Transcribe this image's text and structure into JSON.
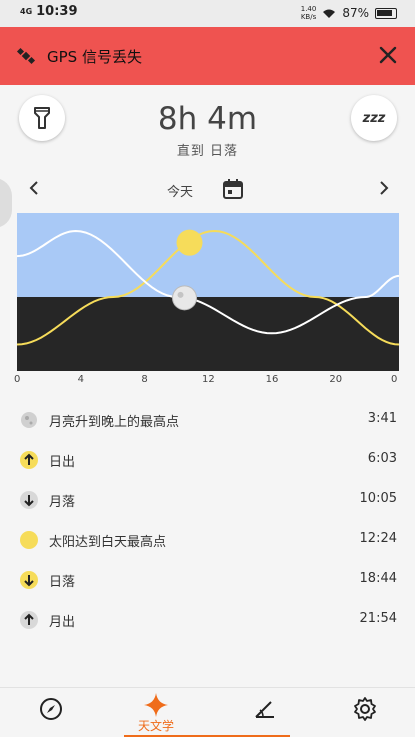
{
  "status_bar": {
    "network": "4G",
    "time": "10:39",
    "net_speed_top": "1.40",
    "net_speed_bottom": "KB/s",
    "battery": "87%"
  },
  "banner": {
    "text": "GPS 信号丢失",
    "icon": "satellite-icon",
    "color": "#ef5350"
  },
  "header": {
    "duration": "8h 4m",
    "subtitle": "直到 日落",
    "left_button_icon": "flashlight-icon",
    "right_button_text": "zzz"
  },
  "date_nav": {
    "label": "今天",
    "prev_icon": "chevron-left-icon",
    "next_icon": "chevron-right-icon",
    "calendar_icon": "calendar-icon"
  },
  "chart_data": {
    "type": "line",
    "x_ticks": [
      "0",
      "4",
      "8",
      "12",
      "16",
      "20",
      "0"
    ],
    "xlim": [
      0,
      24
    ],
    "colors": {
      "sky": "#a9c9f6",
      "night": "#262626",
      "sun": "#f6dc5a",
      "moon": "#ffffff"
    },
    "series": [
      {
        "key": "sun",
        "values": [
          [
            0,
            -0.72
          ],
          [
            6.05,
            0
          ],
          [
            12.4,
            1.0
          ],
          [
            18.73,
            0
          ],
          [
            24,
            -0.72
          ]
        ]
      },
      {
        "key": "moon",
        "values": [
          [
            0,
            0.62
          ],
          [
            3.68,
            1.0
          ],
          [
            10.08,
            0
          ],
          [
            16.0,
            -0.55
          ],
          [
            21.9,
            0
          ],
          [
            24,
            0.32
          ]
        ]
      }
    ],
    "current_time": 10.65
  },
  "events": [
    {
      "label": "月亮升到晚上的最高点",
      "time": "3:41",
      "icon": "moon-phase-icon"
    },
    {
      "label": "日出",
      "time": "6:03",
      "icon": "sunrise-icon"
    },
    {
      "label": "月落",
      "time": "10:05",
      "icon": "moonset-icon"
    },
    {
      "label": "太阳达到白天最高点",
      "time": "12:24",
      "icon": "sun-icon"
    },
    {
      "label": "日落",
      "time": "18:44",
      "icon": "sunset-icon"
    },
    {
      "label": "月出",
      "time": "21:54",
      "icon": "moonrise-icon"
    }
  ],
  "bottom_nav": {
    "active_label": "天文学",
    "accent": "#ef6c1a",
    "items": [
      "compass-icon",
      "astronomy-icon",
      "angle-icon",
      "settings-icon"
    ]
  }
}
